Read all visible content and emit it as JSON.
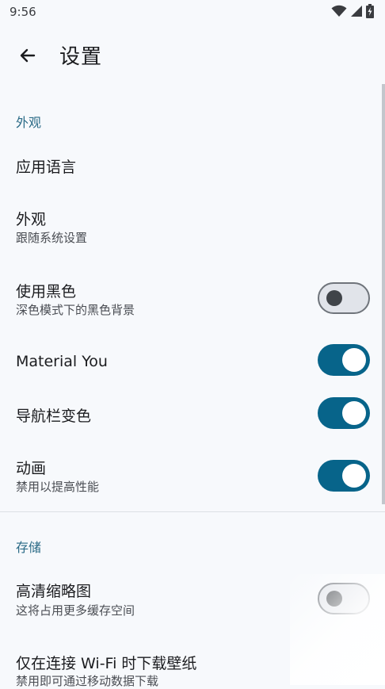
{
  "status": {
    "time": "9:56",
    "icons": [
      "wifi-icon",
      "signal-icon",
      "battery-charging-icon"
    ]
  },
  "appbar": {
    "back_icon": "arrow-left-icon",
    "title": "设置"
  },
  "sections": {
    "appearance": {
      "header": "外观",
      "app_language": {
        "title": "应用语言"
      },
      "theme": {
        "title": "外观",
        "subtitle": "跟随系统设置"
      },
      "black_theme": {
        "title": "使用黑色",
        "subtitle": "深色模式下的黑色背景",
        "enabled": false
      },
      "material_you": {
        "title": "Material You",
        "enabled": true
      },
      "nav_bar_color": {
        "title": "导航栏变色",
        "enabled": true
      },
      "animations": {
        "title": "动画",
        "subtitle": "禁用以提高性能",
        "enabled": true
      }
    },
    "storage": {
      "header": "存储",
      "hd_thumbnails": {
        "title": "高清缩略图",
        "subtitle": "这将占用更多缓存空间",
        "enabled": false
      },
      "wifi_only": {
        "title": "仅在连接 Wi-Fi 时下载壁纸",
        "subtitle": "禁用即可通过移动数据下载"
      }
    }
  },
  "colors": {
    "accent": "#07648a",
    "section_header": "#2a6a86",
    "background": "#f7f9fc"
  }
}
